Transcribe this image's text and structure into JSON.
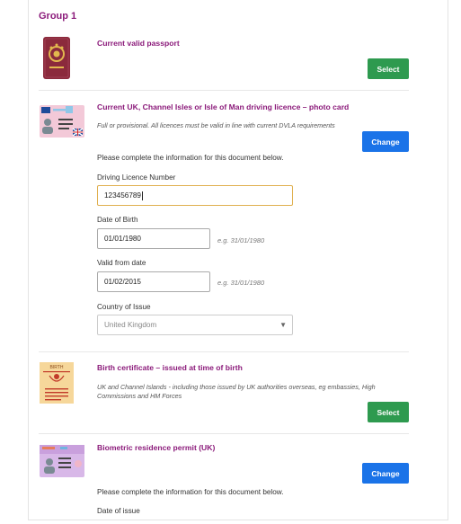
{
  "group": {
    "title": "Group 1"
  },
  "docs": [
    {
      "title": "Current valid passport",
      "button": "Select",
      "icon_text": "PASSPORT"
    },
    {
      "title": "Current UK, Channel Isles or Isle of Man driving licence – photo card",
      "note": "Full or provisional. All licences must be valid in line with current DVLA requirements",
      "button": "Change",
      "icon_text": "UK",
      "instruction": "Please complete the information for this document below.",
      "fields": {
        "licence_number": {
          "label": "Driving Licence Number",
          "value": "123456789"
        },
        "dob": {
          "label": "Date of Birth",
          "value": "01/01/1980",
          "example": "e.g. 31/01/1980"
        },
        "valid_from": {
          "label": "Valid from date",
          "value": "01/02/2015",
          "example": "e.g. 31/01/1980"
        },
        "country": {
          "label": "Country of Issue",
          "value": "United Kingdom"
        }
      }
    },
    {
      "title": "Birth certificate – issued at time of birth",
      "note": "UK and Channel Islands - including those issued by UK authorities overseas, eg embassies, High Commissions and HM Forces",
      "button": "Select",
      "icon_text": "BIRTH"
    },
    {
      "title": "Biometric residence permit (UK)",
      "button": "Change",
      "instruction": "Please complete the information for this document below.",
      "next_label": "Date of issue"
    }
  ],
  "colors": {
    "accent": "#8b1a7a",
    "select_button": "#2e9a4f",
    "change_button": "#1a73e8"
  }
}
